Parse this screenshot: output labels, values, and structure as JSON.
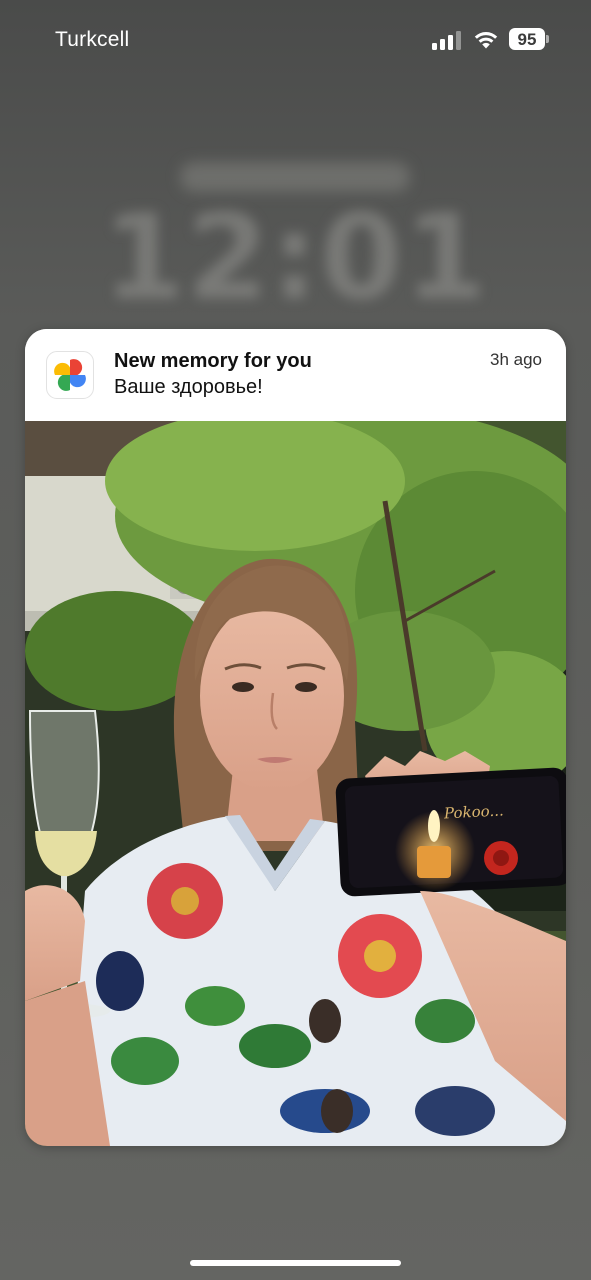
{
  "status_bar": {
    "carrier": "Turkcell",
    "signal_bars": 3,
    "battery_level": "95",
    "icons": [
      "signal-icon",
      "wifi-icon",
      "battery-icon"
    ]
  },
  "lock_screen": {
    "clock": "12:01"
  },
  "notification": {
    "app_icon": "google-photos-icon",
    "title": "New memory for you",
    "body": "Ваше здоровье!",
    "time": "3h ago",
    "photo_caption_text": "Pokoo..."
  },
  "colors": {
    "accent_red": "#ea4335",
    "accent_yellow": "#fbbc04",
    "accent_green": "#34a853",
    "accent_blue": "#4285f4"
  }
}
